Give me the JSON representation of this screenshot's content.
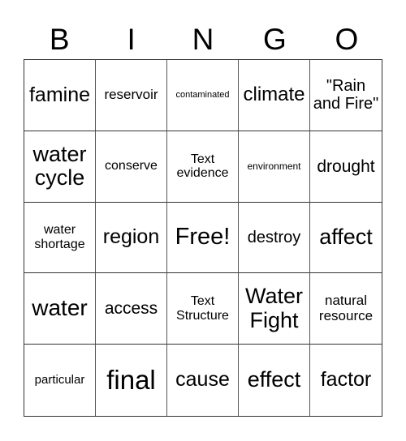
{
  "header": [
    "B",
    "I",
    "N",
    "G",
    "O"
  ],
  "cells": [
    {
      "text": "famine",
      "size": 25
    },
    {
      "text": "reservoir",
      "size": 17
    },
    {
      "text": "contaminated",
      "size": 11
    },
    {
      "text": "climate",
      "size": 24
    },
    {
      "text": "\"Rain and Fire\"",
      "size": 20
    },
    {
      "text": "water cycle",
      "size": 27
    },
    {
      "text": "conserve",
      "size": 16
    },
    {
      "text": "Text evidence",
      "size": 16
    },
    {
      "text": "environment",
      "size": 12
    },
    {
      "text": "drought",
      "size": 21
    },
    {
      "text": "water shortage",
      "size": 16
    },
    {
      "text": "region",
      "size": 25
    },
    {
      "text": "Free!",
      "size": 29
    },
    {
      "text": "destroy",
      "size": 20
    },
    {
      "text": "affect",
      "size": 27
    },
    {
      "text": "water",
      "size": 28
    },
    {
      "text": "access",
      "size": 21
    },
    {
      "text": "Text Structure",
      "size": 16
    },
    {
      "text": "Water Fight",
      "size": 27
    },
    {
      "text": "natural resource",
      "size": 17
    },
    {
      "text": "particular",
      "size": 15
    },
    {
      "text": "final",
      "size": 33
    },
    {
      "text": "cause",
      "size": 25
    },
    {
      "text": "effect",
      "size": 27
    },
    {
      "text": "factor",
      "size": 25
    }
  ]
}
